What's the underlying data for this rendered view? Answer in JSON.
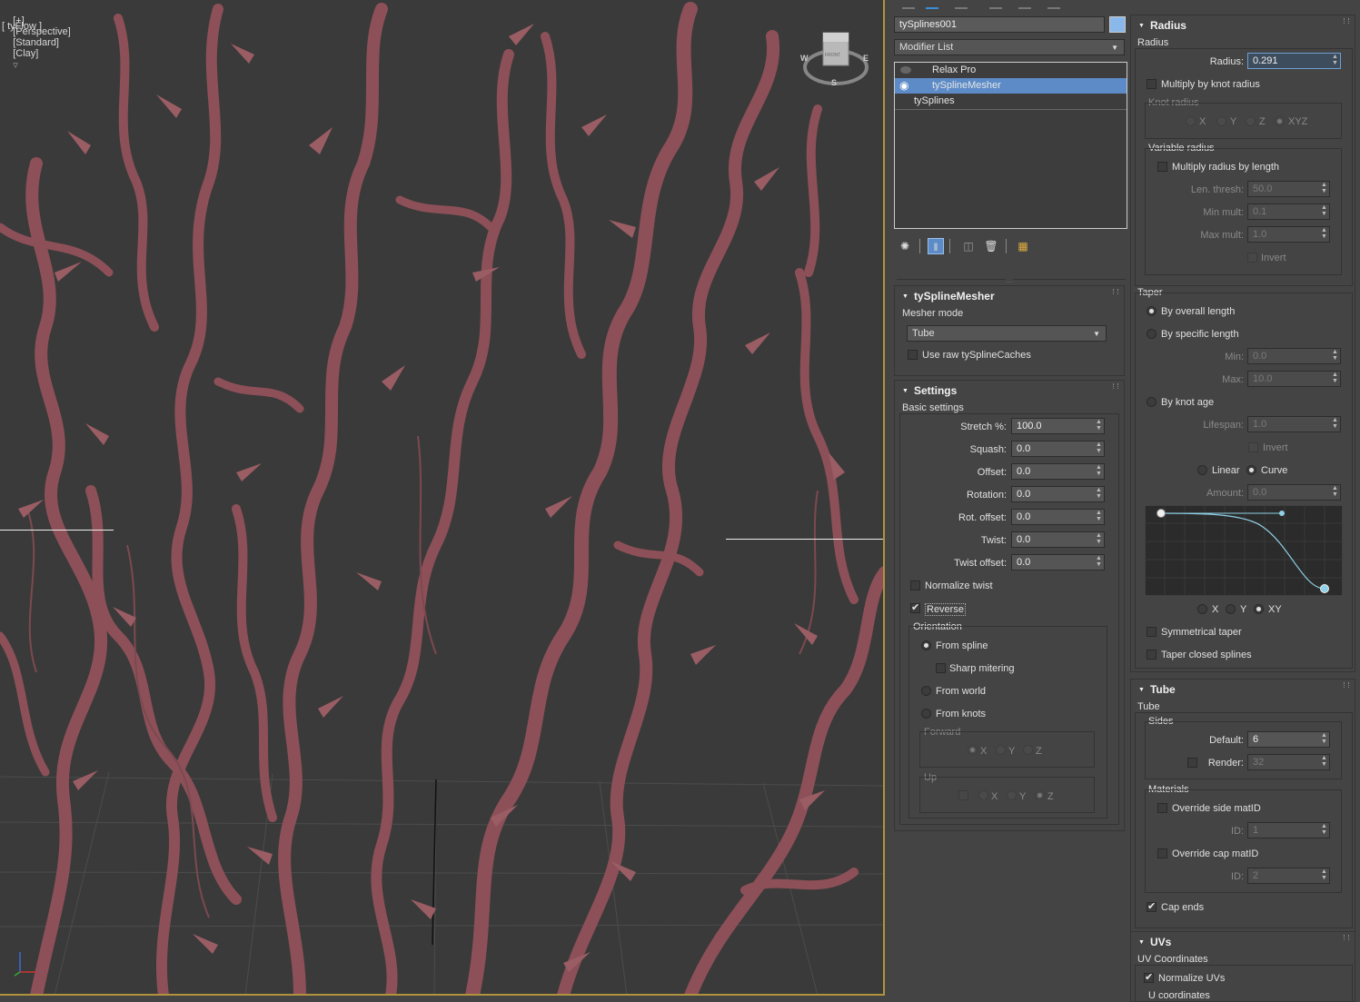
{
  "viewport": {
    "label_menu": "[+]",
    "label_view": "[Perspective]",
    "label_shading1": "[Standard]",
    "label_shading2": "[Clay]",
    "label_tyflow": "[ tyFlow ]",
    "navcube_face": "FRONT",
    "navcube_w": "W",
    "navcube_e": "E",
    "navcube_s": "S"
  },
  "command_panel": {
    "object_name": "tySplines001",
    "object_color": "#8ab8ea",
    "modifier_list": "Modifier List",
    "stack": [
      {
        "label": "Relax Pro"
      },
      {
        "label": "tySplineMesher"
      },
      {
        "label": "tySplines"
      }
    ]
  },
  "mesher": {
    "title": "tySplineMesher",
    "mode_label": "Mesher mode",
    "mode_value": "Tube",
    "use_raw": "Use raw tySplineCaches"
  },
  "settings": {
    "title": "Settings",
    "basic": "Basic settings",
    "fields": [
      {
        "label": "Stretch %:",
        "value": "100.0"
      },
      {
        "label": "Squash:",
        "value": "0.0"
      },
      {
        "label": "Offset:",
        "value": "0.0"
      },
      {
        "label": "Rotation:",
        "value": "0.0"
      },
      {
        "label": "Rot. offset:",
        "value": "0.0"
      },
      {
        "label": "Twist:",
        "value": "0.0"
      },
      {
        "label": "Twist offset:",
        "value": "0.0"
      }
    ],
    "normalize_twist": "Normalize twist",
    "reverse": "Reverse",
    "orientation": "Orientation",
    "from_spline": "From spline",
    "sharp_mitering": "Sharp mitering",
    "from_world": "From world",
    "from_knots": "From knots",
    "forward": "Forward",
    "up": "Up",
    "x": "X",
    "y": "Y",
    "z": "Z"
  },
  "radius": {
    "title": "Radius",
    "group": "Radius",
    "radius_label": "Radius:",
    "radius_value": "0.291",
    "multiply_knot": "Multiply by knot radius",
    "knot_radius": "Knot radius",
    "x": "X",
    "y": "Y",
    "z": "Z",
    "xyz": "XYZ",
    "variable_radius": "Variable radius",
    "multiply_length": "Multiply radius by length",
    "len_thresh_label": "Len. thresh:",
    "len_thresh_value": "50.0",
    "min_mult_label": "Min mult:",
    "min_mult_value": "0.1",
    "max_mult_label": "Max mult:",
    "max_mult_value": "1.0",
    "invert": "Invert"
  },
  "taper": {
    "group": "Taper",
    "by_overall": "By overall length",
    "by_specific": "By specific length",
    "min_label": "Min:",
    "min_value": "0.0",
    "max_label": "Max:",
    "max_value": "10.0",
    "by_knot_age": "By knot age",
    "lifespan_label": "Lifespan:",
    "lifespan_value": "1.0",
    "invert": "Invert",
    "linear": "Linear",
    "curve": "Curve",
    "amount_label": "Amount:",
    "amount_value": "0.0",
    "x": "X",
    "y": "Y",
    "xy": "XY",
    "symmetrical": "Symmetrical taper",
    "closed": "Taper closed splines"
  },
  "tube": {
    "title": "Tube",
    "group": "Tube",
    "sides": "Sides",
    "default_label": "Default:",
    "default_value": "6",
    "render_label": "Render:",
    "render_value": "32",
    "materials": "Materials",
    "override_side": "Override side matID",
    "id_label": "ID:",
    "side_id": "1",
    "override_cap": "Override cap matID",
    "cap_id": "2",
    "cap_ends": "Cap ends"
  },
  "uvs": {
    "title": "UVs",
    "group": "UV Coordinates",
    "normalize": "Normalize UVs",
    "u_coords": "U coordinates"
  }
}
